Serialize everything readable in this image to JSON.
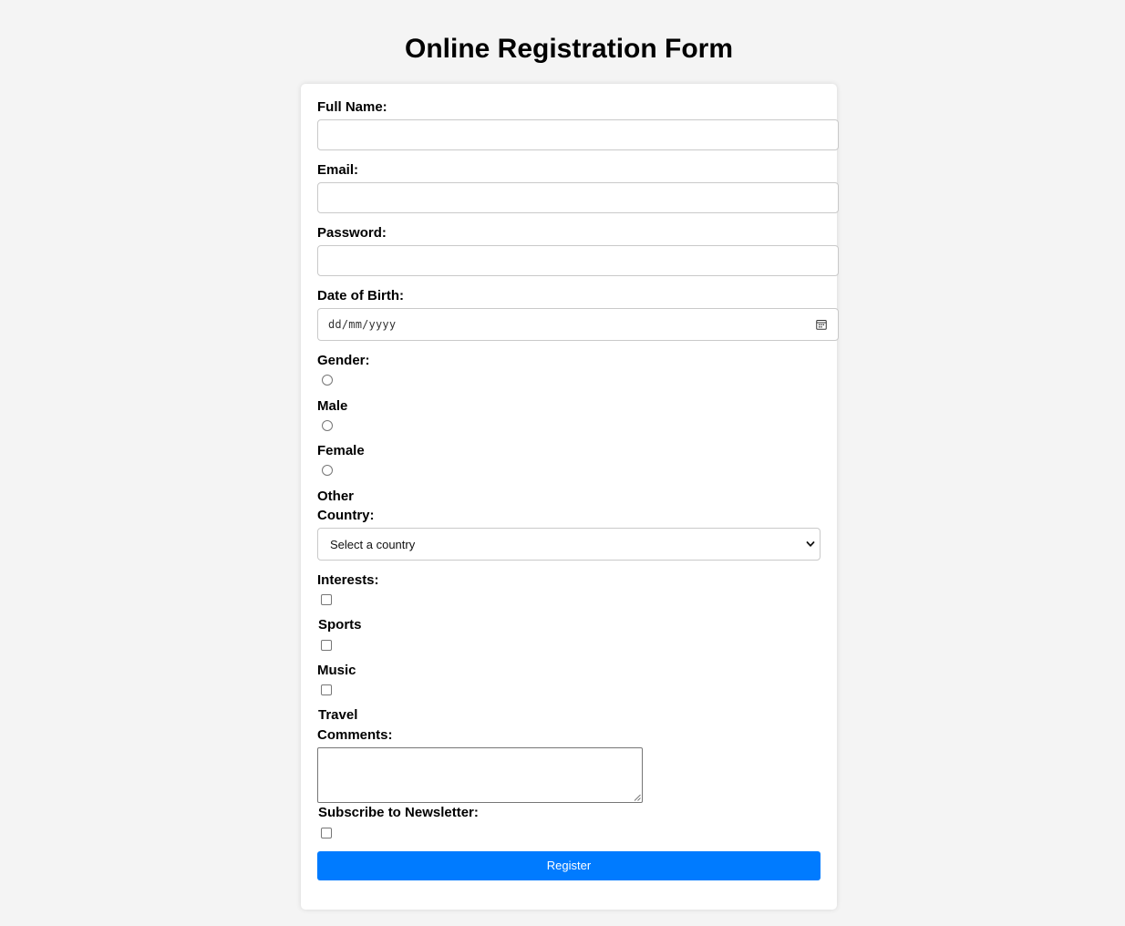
{
  "page": {
    "title": "Online Registration Form"
  },
  "form": {
    "full_name": {
      "label": "Full Name:",
      "value": ""
    },
    "email": {
      "label": "Email:",
      "value": ""
    },
    "password": {
      "label": "Password:",
      "value": ""
    },
    "dob": {
      "label": "Date of Birth:",
      "placeholder": "dd/mm/yyyy",
      "icon": "calendar-icon"
    },
    "gender": {
      "label": "Gender:",
      "options": [
        {
          "label": "Male",
          "checked": false
        },
        {
          "label": "Female",
          "checked": false
        },
        {
          "label": "Other",
          "checked": false
        }
      ]
    },
    "country": {
      "label": "Country:",
      "selected": "Select a country",
      "icon": "chevron-down-icon"
    },
    "interests": {
      "label": "Interests:",
      "options": [
        {
          "label": "Sports",
          "checked": false
        },
        {
          "label": "Music",
          "checked": false
        },
        {
          "label": "Travel",
          "checked": false
        }
      ]
    },
    "comments": {
      "label": "Comments:",
      "value": ""
    },
    "newsletter": {
      "label": "Subscribe to Newsletter:",
      "checked": false
    },
    "register_label": "Register"
  },
  "colors": {
    "accent": "#007bff",
    "background": "#f4f4f4",
    "card": "#ffffff"
  }
}
